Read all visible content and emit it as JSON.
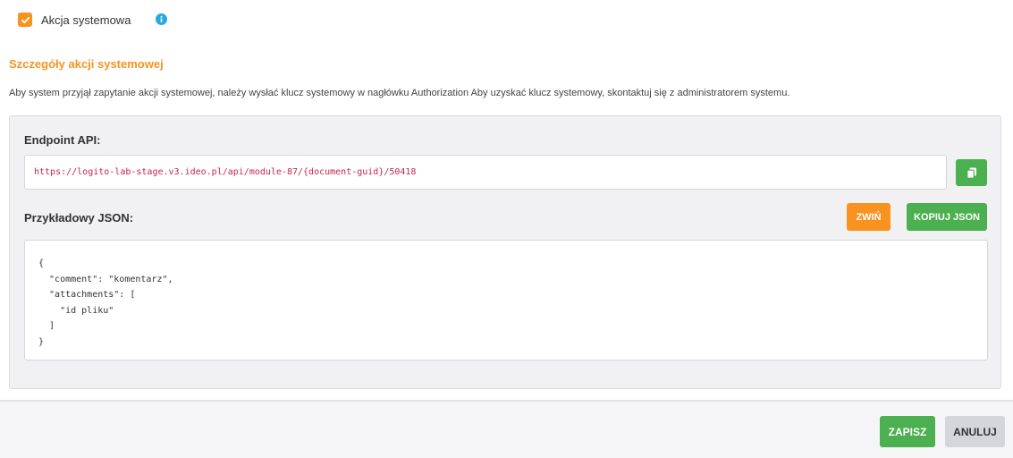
{
  "system_action": {
    "checkbox_label": "Akcja systemowa",
    "checked": true
  },
  "details": {
    "title": "Szczegóły akcji systemowej",
    "description": "Aby system przyjął zapytanie akcji systemowej, należy wysłać klucz systemowy w nagłówku Authorization Aby uzyskać klucz systemowy, skontaktuj się z administratorem systemu."
  },
  "endpoint": {
    "label": "Endpoint API:",
    "url": "https://logito-lab-stage.v3.ideo.pl/api/module-87/{document-guid}/50418"
  },
  "json_example": {
    "label": "Przykładowy JSON:",
    "collapse_label": "ZWIŃ",
    "copy_label": "KOPIUJ JSON",
    "lines": [
      "{",
      "  \"comment\": \"komentarz\",",
      "  \"attachments\": [",
      "    \"id pliku\"",
      "  ]",
      "}"
    ]
  },
  "footer": {
    "save_label": "ZAPISZ",
    "cancel_label": "ANULUJ"
  },
  "colors": {
    "accent_orange": "#f7931e",
    "success_green": "#4caf50",
    "info_blue": "#29a9e0",
    "url_text": "#c7254e"
  },
  "icons": {
    "checkbox": "check-icon",
    "info": "info-icon",
    "copy": "copy-icon"
  }
}
